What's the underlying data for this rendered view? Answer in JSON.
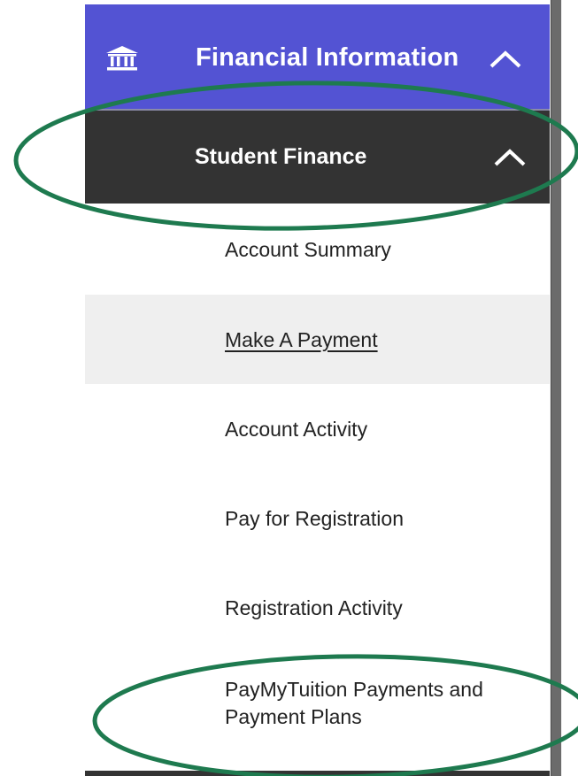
{
  "nav": {
    "financial_header": {
      "label": "Financial Information",
      "icon": "bank-icon",
      "toggle_icon": "chevron-up-icon",
      "color": "#5353d3"
    },
    "student_finance_header": {
      "label": "Student Finance",
      "toggle_icon": "chevron-up-icon",
      "color": "#333333"
    },
    "items": [
      {
        "label": "Account Summary",
        "active": false
      },
      {
        "label": "Make A Payment",
        "active": true
      },
      {
        "label": "Account Activity",
        "active": false
      },
      {
        "label": "Pay for Registration",
        "active": false
      },
      {
        "label": "Registration Activity",
        "active": false
      },
      {
        "label": "PayMyTuition Payments and Payment Plans",
        "active": false
      }
    ]
  },
  "annotation": {
    "color": "#1e7a4f",
    "shape": "ellipse-highlight"
  }
}
